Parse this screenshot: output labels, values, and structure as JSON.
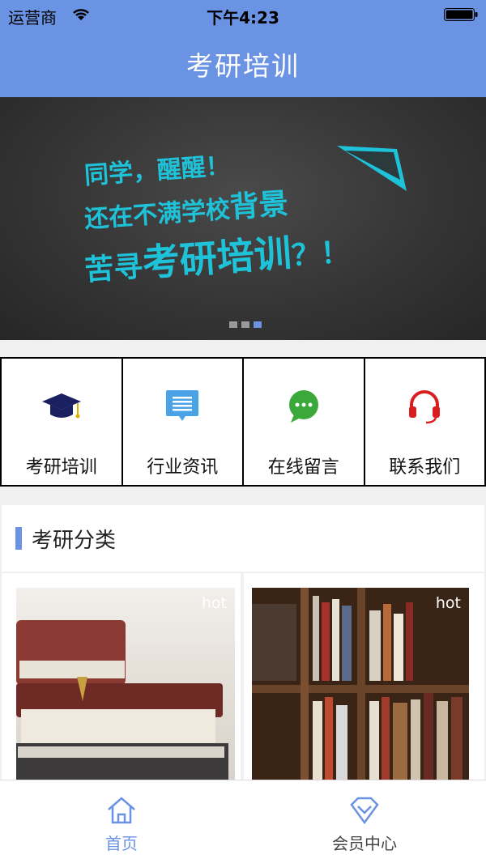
{
  "status_bar": {
    "carrier": "运营商",
    "time": "下午4:23"
  },
  "nav": {
    "title": "考研培训"
  },
  "banner": {
    "line1": "同学，醒醒！",
    "line2_a": "还在不满学校",
    "line2_b": "背景",
    "line3_a": "苦寻",
    "line3_b": "考研培训",
    "line3_c": "？！",
    "accent_color": "#1ec3da",
    "pager": {
      "count": 3,
      "active_index": 2
    }
  },
  "grid": [
    {
      "label": "考研培训",
      "icon": "graduation-cap-icon"
    },
    {
      "label": "行业资讯",
      "icon": "news-icon"
    },
    {
      "label": "在线留言",
      "icon": "chat-bubble-icon"
    },
    {
      "label": "联系我们",
      "icon": "headset-icon"
    }
  ],
  "category": {
    "title": "考研分类"
  },
  "cards": [
    {
      "badge": "hot",
      "image": "books-stack-image"
    },
    {
      "badge": "hot",
      "image": "bookshelf-image"
    }
  ],
  "tabs": [
    {
      "label": "首页",
      "icon": "home-icon",
      "active": true
    },
    {
      "label": "会员中心",
      "icon": "diamond-icon",
      "active": false
    }
  ],
  "colors": {
    "primary": "#6b93e3",
    "accent": "#1ec3da"
  }
}
